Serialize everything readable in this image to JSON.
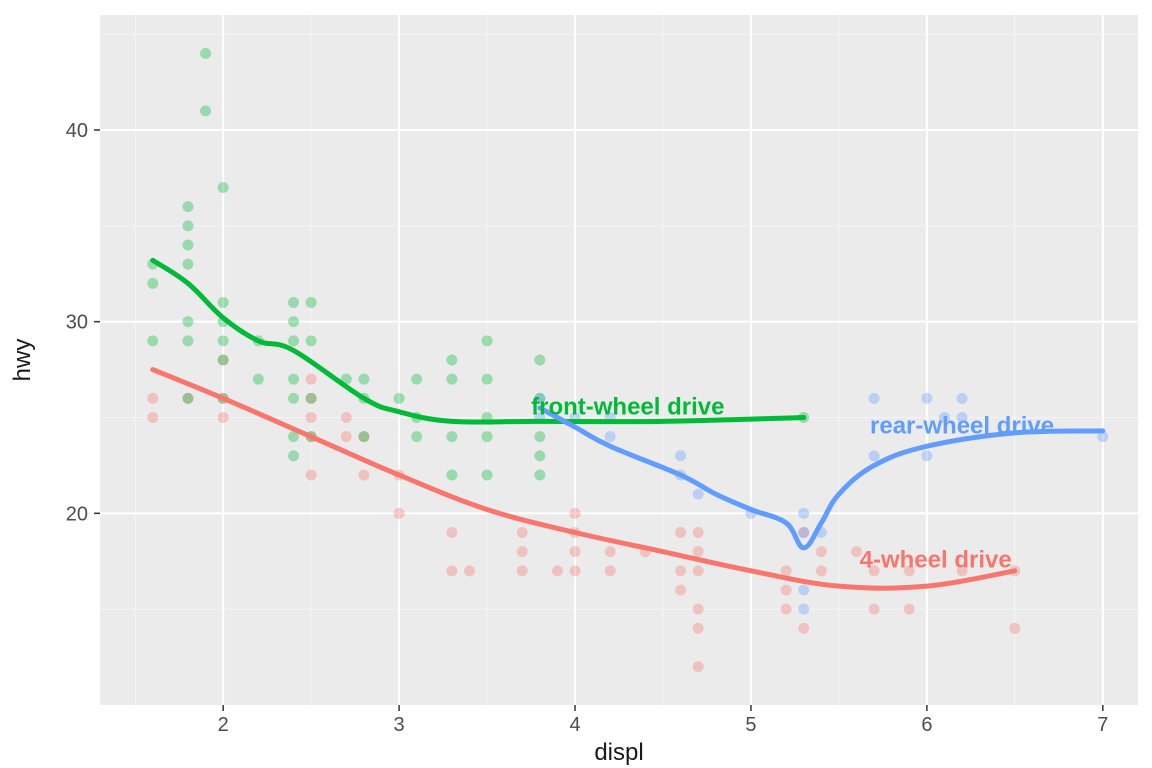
{
  "chart_data": {
    "type": "scatter",
    "xlabel": "displ",
    "ylabel": "hwy",
    "xlim": [
      1.3,
      7.2
    ],
    "ylim": [
      10,
      46
    ],
    "x_ticks": [
      2,
      3,
      4,
      5,
      6,
      7
    ],
    "y_ticks": [
      20,
      30,
      40
    ],
    "series": [
      {
        "name": "4-wheel drive",
        "color": "#F8766D",
        "label_pos": {
          "x": 6.05,
          "y": 17.5
        },
        "smooth": [
          {
            "x": 1.6,
            "y": 27.5
          },
          {
            "x": 2.0,
            "y": 26.0
          },
          {
            "x": 2.5,
            "y": 24.0
          },
          {
            "x": 3.0,
            "y": 22.0
          },
          {
            "x": 3.5,
            "y": 20.2
          },
          {
            "x": 4.0,
            "y": 19.0
          },
          {
            "x": 4.5,
            "y": 18.0
          },
          {
            "x": 5.0,
            "y": 17.0
          },
          {
            "x": 5.5,
            "y": 16.2
          },
          {
            "x": 6.0,
            "y": 16.2
          },
          {
            "x": 6.5,
            "y": 17.0
          }
        ],
        "points": [
          {
            "x": 1.6,
            "y": 26
          },
          {
            "x": 1.6,
            "y": 25
          },
          {
            "x": 1.8,
            "y": 26
          },
          {
            "x": 2.0,
            "y": 28
          },
          {
            "x": 2.0,
            "y": 26
          },
          {
            "x": 2.0,
            "y": 25
          },
          {
            "x": 2.5,
            "y": 26
          },
          {
            "x": 2.5,
            "y": 25
          },
          {
            "x": 2.5,
            "y": 24
          },
          {
            "x": 2.5,
            "y": 27
          },
          {
            "x": 2.5,
            "y": 22
          },
          {
            "x": 2.7,
            "y": 24
          },
          {
            "x": 2.7,
            "y": 25
          },
          {
            "x": 2.8,
            "y": 24
          },
          {
            "x": 2.8,
            "y": 22
          },
          {
            "x": 3.0,
            "y": 22
          },
          {
            "x": 3.0,
            "y": 20
          },
          {
            "x": 3.3,
            "y": 19
          },
          {
            "x": 3.3,
            "y": 17
          },
          {
            "x": 3.4,
            "y": 17
          },
          {
            "x": 3.7,
            "y": 19
          },
          {
            "x": 3.7,
            "y": 18
          },
          {
            "x": 3.7,
            "y": 17
          },
          {
            "x": 3.9,
            "y": 17
          },
          {
            "x": 4.0,
            "y": 20
          },
          {
            "x": 4.0,
            "y": 19
          },
          {
            "x": 4.0,
            "y": 18
          },
          {
            "x": 4.0,
            "y": 17
          },
          {
            "x": 4.2,
            "y": 17
          },
          {
            "x": 4.2,
            "y": 18
          },
          {
            "x": 4.4,
            "y": 18
          },
          {
            "x": 4.6,
            "y": 19
          },
          {
            "x": 4.6,
            "y": 17
          },
          {
            "x": 4.6,
            "y": 16
          },
          {
            "x": 4.7,
            "y": 19
          },
          {
            "x": 4.7,
            "y": 18
          },
          {
            "x": 4.7,
            "y": 17
          },
          {
            "x": 4.7,
            "y": 15
          },
          {
            "x": 4.7,
            "y": 14
          },
          {
            "x": 4.7,
            "y": 12
          },
          {
            "x": 5.2,
            "y": 17
          },
          {
            "x": 5.2,
            "y": 16
          },
          {
            "x": 5.2,
            "y": 15
          },
          {
            "x": 5.3,
            "y": 19
          },
          {
            "x": 5.3,
            "y": 14
          },
          {
            "x": 5.4,
            "y": 17
          },
          {
            "x": 5.4,
            "y": 18
          },
          {
            "x": 5.6,
            "y": 18
          },
          {
            "x": 5.7,
            "y": 17
          },
          {
            "x": 5.7,
            "y": 15
          },
          {
            "x": 5.9,
            "y": 17
          },
          {
            "x": 5.9,
            "y": 15
          },
          {
            "x": 6.2,
            "y": 17
          },
          {
            "x": 6.5,
            "y": 17
          },
          {
            "x": 6.5,
            "y": 14
          }
        ]
      },
      {
        "name": "front-wheel drive",
        "color": "#00BA38",
        "label_pos": {
          "x": 4.3,
          "y": 25.5
        },
        "smooth": [
          {
            "x": 1.6,
            "y": 33.2
          },
          {
            "x": 1.8,
            "y": 32.0
          },
          {
            "x": 2.0,
            "y": 30.2
          },
          {
            "x": 2.2,
            "y": 29.0
          },
          {
            "x": 2.4,
            "y": 28.5
          },
          {
            "x": 2.8,
            "y": 26.0
          },
          {
            "x": 3.0,
            "y": 25.3
          },
          {
            "x": 3.3,
            "y": 24.8
          },
          {
            "x": 3.8,
            "y": 24.8
          },
          {
            "x": 4.5,
            "y": 24.8
          },
          {
            "x": 5.3,
            "y": 25.0
          }
        ],
        "points": [
          {
            "x": 1.6,
            "y": 33
          },
          {
            "x": 1.6,
            "y": 32
          },
          {
            "x": 1.6,
            "y": 29
          },
          {
            "x": 1.8,
            "y": 36
          },
          {
            "x": 1.8,
            "y": 35
          },
          {
            "x": 1.8,
            "y": 34
          },
          {
            "x": 1.8,
            "y": 33
          },
          {
            "x": 1.8,
            "y": 30
          },
          {
            "x": 1.8,
            "y": 29
          },
          {
            "x": 1.8,
            "y": 26
          },
          {
            "x": 1.9,
            "y": 44
          },
          {
            "x": 1.9,
            "y": 41
          },
          {
            "x": 2.0,
            "y": 37
          },
          {
            "x": 2.0,
            "y": 31
          },
          {
            "x": 2.0,
            "y": 30
          },
          {
            "x": 2.0,
            "y": 29
          },
          {
            "x": 2.0,
            "y": 28
          },
          {
            "x": 2.0,
            "y": 26
          },
          {
            "x": 2.2,
            "y": 29
          },
          {
            "x": 2.2,
            "y": 27
          },
          {
            "x": 2.4,
            "y": 31
          },
          {
            "x": 2.4,
            "y": 30
          },
          {
            "x": 2.4,
            "y": 29
          },
          {
            "x": 2.4,
            "y": 27
          },
          {
            "x": 2.4,
            "y": 26
          },
          {
            "x": 2.4,
            "y": 24
          },
          {
            "x": 2.4,
            "y": 23
          },
          {
            "x": 2.5,
            "y": 31
          },
          {
            "x": 2.5,
            "y": 29
          },
          {
            "x": 2.5,
            "y": 26
          },
          {
            "x": 2.5,
            "y": 24
          },
          {
            "x": 2.7,
            "y": 27
          },
          {
            "x": 2.8,
            "y": 27
          },
          {
            "x": 2.8,
            "y": 26
          },
          {
            "x": 2.8,
            "y": 24
          },
          {
            "x": 3.0,
            "y": 26
          },
          {
            "x": 3.1,
            "y": 27
          },
          {
            "x": 3.1,
            "y": 25
          },
          {
            "x": 3.1,
            "y": 24
          },
          {
            "x": 3.3,
            "y": 28
          },
          {
            "x": 3.3,
            "y": 27
          },
          {
            "x": 3.3,
            "y": 24
          },
          {
            "x": 3.3,
            "y": 22
          },
          {
            "x": 3.5,
            "y": 29
          },
          {
            "x": 3.5,
            "y": 27
          },
          {
            "x": 3.5,
            "y": 25
          },
          {
            "x": 3.5,
            "y": 24
          },
          {
            "x": 3.5,
            "y": 22
          },
          {
            "x": 3.8,
            "y": 28
          },
          {
            "x": 3.8,
            "y": 26
          },
          {
            "x": 3.8,
            "y": 24
          },
          {
            "x": 3.8,
            "y": 23
          },
          {
            "x": 3.8,
            "y": 22
          },
          {
            "x": 5.3,
            "y": 25
          }
        ]
      },
      {
        "name": "rear-wheel drive",
        "color": "#619CFF",
        "label_pos": {
          "x": 6.2,
          "y": 24.5
        },
        "smooth": [
          {
            "x": 3.8,
            "y": 25.5
          },
          {
            "x": 4.0,
            "y": 24.5
          },
          {
            "x": 4.2,
            "y": 23.5
          },
          {
            "x": 4.6,
            "y": 22.0
          },
          {
            "x": 4.8,
            "y": 21.0
          },
          {
            "x": 5.0,
            "y": 20.2
          },
          {
            "x": 5.2,
            "y": 19.5
          },
          {
            "x": 5.3,
            "y": 18.2
          },
          {
            "x": 5.4,
            "y": 19.5
          },
          {
            "x": 5.5,
            "y": 21.0
          },
          {
            "x": 5.7,
            "y": 22.5
          },
          {
            "x": 6.0,
            "y": 23.5
          },
          {
            "x": 6.5,
            "y": 24.2
          },
          {
            "x": 7.0,
            "y": 24.3
          }
        ],
        "points": [
          {
            "x": 3.8,
            "y": 26
          },
          {
            "x": 3.8,
            "y": 25
          },
          {
            "x": 4.0,
            "y": 25
          },
          {
            "x": 4.2,
            "y": 25
          },
          {
            "x": 4.2,
            "y": 24
          },
          {
            "x": 4.6,
            "y": 23
          },
          {
            "x": 4.6,
            "y": 22
          },
          {
            "x": 4.7,
            "y": 21
          },
          {
            "x": 5.0,
            "y": 20
          },
          {
            "x": 5.3,
            "y": 20
          },
          {
            "x": 5.3,
            "y": 19
          },
          {
            "x": 5.3,
            "y": 16
          },
          {
            "x": 5.3,
            "y": 15
          },
          {
            "x": 5.4,
            "y": 19
          },
          {
            "x": 5.7,
            "y": 26
          },
          {
            "x": 5.7,
            "y": 23
          },
          {
            "x": 6.0,
            "y": 26
          },
          {
            "x": 6.0,
            "y": 23
          },
          {
            "x": 6.1,
            "y": 25
          },
          {
            "x": 6.2,
            "y": 26
          },
          {
            "x": 6.2,
            "y": 25
          },
          {
            "x": 7.0,
            "y": 24
          }
        ]
      }
    ]
  }
}
